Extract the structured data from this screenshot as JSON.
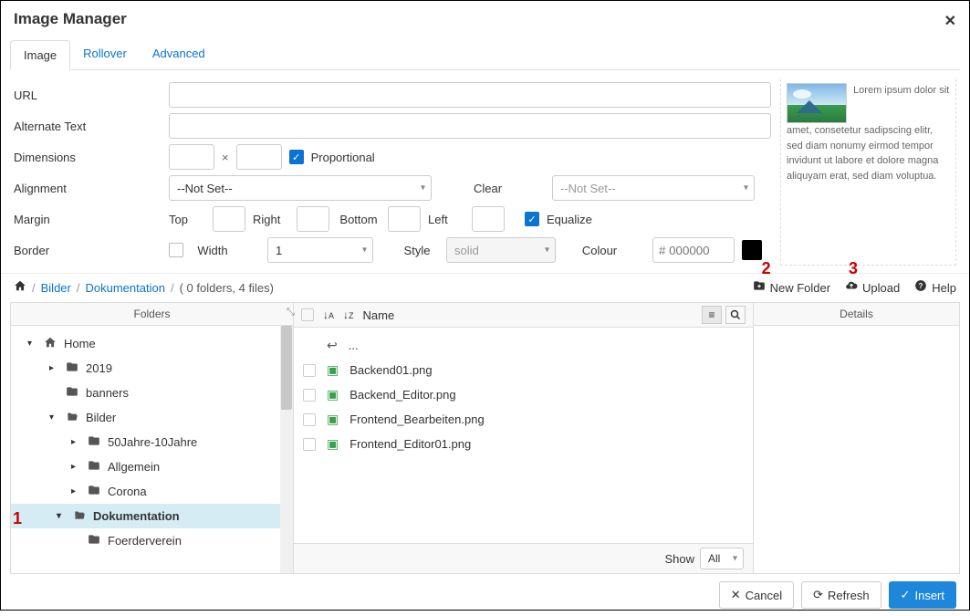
{
  "title": "Image Manager",
  "tabs": {
    "image": "Image",
    "rollover": "Rollover",
    "advanced": "Advanced"
  },
  "form": {
    "url_label": "URL",
    "alt_label": "Alternate Text",
    "dim_label": "Dimensions",
    "mult": "×",
    "proportional": "Proportional",
    "align_label": "Alignment",
    "align_value": "--Not Set--",
    "clear_label": "Clear",
    "clear_value": "--Not Set--",
    "margin_label": "Margin",
    "top": "Top",
    "right": "Right",
    "bottom": "Bottom",
    "left": "Left",
    "equalize": "Equalize",
    "border_label": "Border",
    "width_label": "Width",
    "width_value": "1",
    "style_label": "Style",
    "style_value": "solid",
    "colour_label": "Colour",
    "colour_value": "# 000000"
  },
  "preview_text": "Lorem ipsum dolor sit amet, consetetur sadipscing elitr, sed diam nonumy eirmod tempor invidunt ut labore et dolore magna aliquyam erat, sed diam voluptua.",
  "breadcrumb": {
    "seg1": "Bilder",
    "seg2": "Dokumentation",
    "stats": "( 0 folders, 4 files)"
  },
  "toolbar": {
    "new_folder": "New Folder",
    "upload": "Upload",
    "help": "Help"
  },
  "annotations": {
    "a1": "1",
    "a2": "2",
    "a3": "3"
  },
  "columns": {
    "folders": "Folders",
    "name": "Name",
    "details": "Details"
  },
  "tree": {
    "home": "Home",
    "y2019": "2019",
    "banners": "banners",
    "bilder": "Bilder",
    "fifty": "50Jahre-10Jahre",
    "allg": "Allgemein",
    "corona": "Corona",
    "dok": "Dokumentation",
    "foerd": "Foerderverein"
  },
  "files": {
    "up": "...",
    "f1": "Backend01.png",
    "f2": "Backend_Editor.png",
    "f3": "Frontend_Bearbeiten.png",
    "f4": "Frontend_Editor01.png"
  },
  "show_label": "Show",
  "show_value": "All",
  "footer": {
    "cancel": "Cancel",
    "refresh": "Refresh",
    "insert": "Insert"
  }
}
